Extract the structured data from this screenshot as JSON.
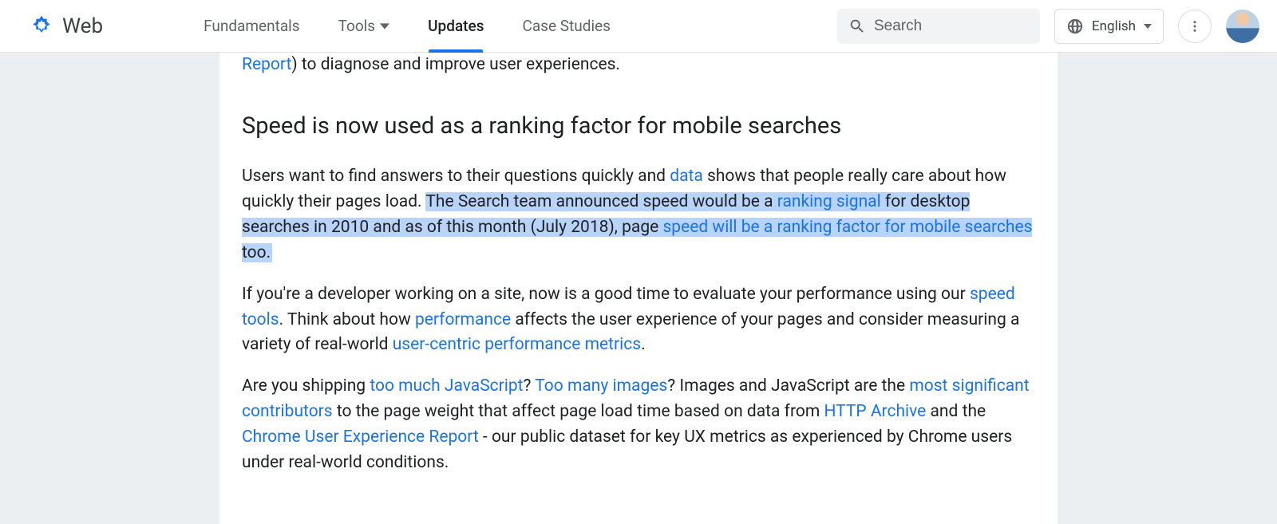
{
  "brand": {
    "name": "Web"
  },
  "nav": {
    "items": [
      {
        "label": "Fundamentals",
        "hasCaret": false,
        "active": false
      },
      {
        "label": "Tools",
        "hasCaret": true,
        "active": false
      },
      {
        "label": "Updates",
        "hasCaret": false,
        "active": true
      },
      {
        "label": "Case Studies",
        "hasCaret": false,
        "active": false
      }
    ]
  },
  "search": {
    "placeholder": "Search"
  },
  "language": {
    "label": "English"
  },
  "fragment_top": {
    "link": "Report",
    "after": ") to diagnose and improve user experiences."
  },
  "section_heading": "Speed is now used as a ranking factor for mobile searches",
  "p1": {
    "t1": "Users want to find answers to their questions quickly and ",
    "link_data": "data",
    "t2": " shows that people really care about how quickly their pages load. ",
    "hl1": "The Search team announced speed would be a ",
    "link_ranking": "ranking signal",
    "hl2": " for desktop searches in 2010 and as of this month (July 2018), page ",
    "link_mobile": "speed will be a ranking factor for mobile searches",
    "hl3": " too."
  },
  "p2": {
    "t1": "If you're a developer working on a site, now is a good time to evaluate your performance using our ",
    "link_tools": "speed tools",
    "t2": ". Think about how ",
    "link_perf": "performance",
    "t3": " affects the user experience of your pages and consider measuring a variety of real-world ",
    "link_metrics": "user-centric performance metrics",
    "t4": "."
  },
  "p3": {
    "t1": "Are you shipping ",
    "link_js": "too much JavaScript",
    "t2": "? ",
    "link_img": "Too many images",
    "t3": "? Images and JavaScript are the ",
    "link_contrib": "most significant contributors",
    "t4": " to the page weight that affect page load time based on data from ",
    "link_http": "HTTP Archive",
    "t5": " and the ",
    "link_crux": "Chrome User Experience Report",
    "t6": " - our public dataset for key UX metrics as experienced by Chrome users under real-world conditions."
  }
}
